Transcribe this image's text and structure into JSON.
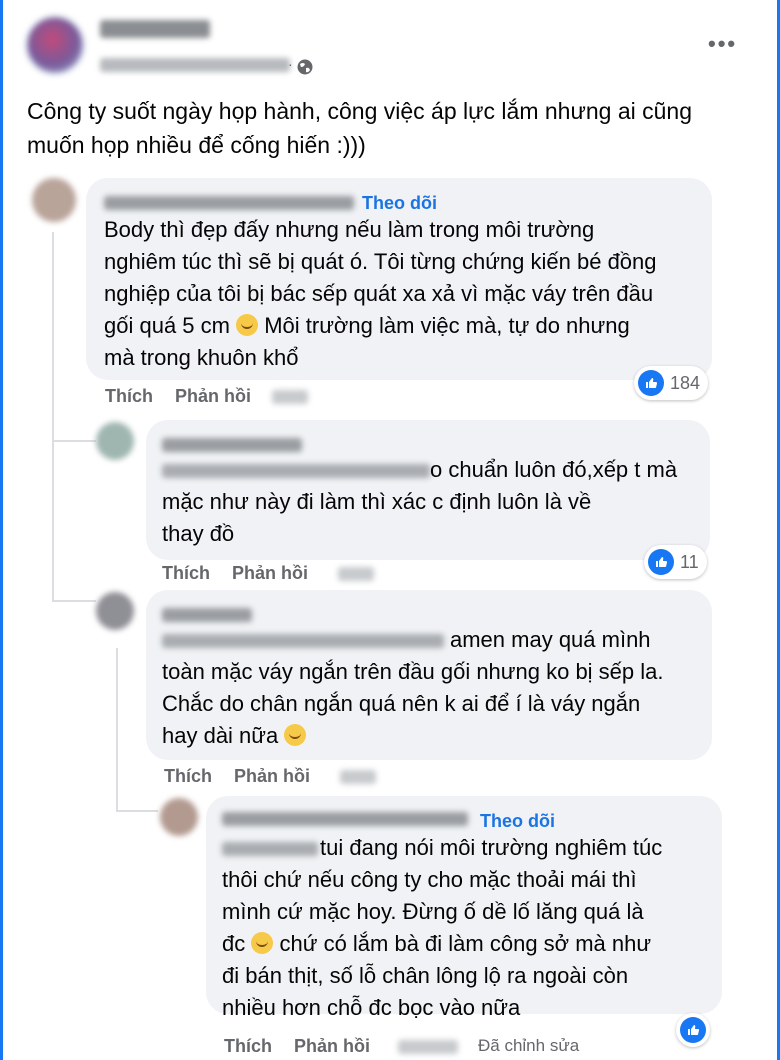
{
  "post": {
    "text": "Công ty suốt ngày họp hành, công việc áp lực lắm nhưng ai cũng muốn họp nhiều để cống hiến :)))"
  },
  "comments": [
    {
      "follow": "Theo dõi",
      "text": "Body thì đẹp đấy nhưng nếu làm trong môi trường\nnghiêm túc thì sẽ bị quát ó. Tôi từng chứng kiến bé đồng\nnghiệp của tôi bị bác sếp quát xa xả vì mặc váy trên đầu\ngối quá 5 cm",
      "text_after_emoji": " Môi trường làm việc mà, tự do nhưng\nmà trong khuôn khổ",
      "reactions": "184",
      "like": "Thích",
      "reply": "Phản hồi"
    },
    {
      "text": "o chuẩn luôn đó,xếp t mà",
      "text2": "mặc như này đi làm thì xác c      định luôn là về\nthay đồ",
      "reactions": "11",
      "like": "Thích",
      "reply": "Phản hồi"
    },
    {
      "text": "amen may quá mình",
      "text2": "toàn mặc váy ngắn trên đầu gối nhưng ko bị sếp la.\nChắc do chân ngắn quá nên k ai để í là váy ngắn\nhay dài nữa",
      "like": "Thích",
      "reply": "Phản hồi"
    },
    {
      "follow": "Theo dõi",
      "text": "tui đang nói môi trường nghiêm túc",
      "text2": "thôi chứ nếu công ty cho mặc thoải mái thì\nmình cứ mặc hoy. Đừng ố dề lố lăng quá là\nđc",
      "text3": " chứ có lắm bà đi làm công sở mà như\nđi bán thịt, số lỗ chân lông lộ ra ngoài còn\nnhiều hơn chỗ đc bọc vào nữa",
      "like": "Thích",
      "reply": "Phản hồi",
      "edited": "Đã chỉnh sửa"
    }
  ],
  "icons": [
    "globe-icon",
    "more-icon",
    "like-icon",
    "emoji-icon"
  ],
  "colors": {
    "accent": "#1877f2",
    "bubble": "#f0f2f5",
    "muted": "#65676b"
  }
}
